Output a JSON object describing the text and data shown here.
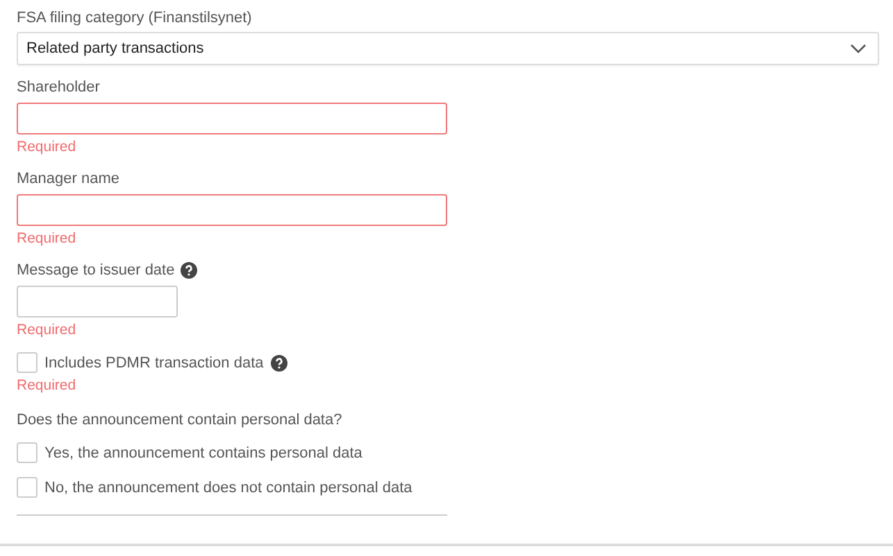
{
  "category": {
    "label": "FSA filing category (Finanstilsynet)",
    "value": "Related party transactions"
  },
  "fields": [
    {
      "label": "Shareholder",
      "kind": "text",
      "invalid": true,
      "help": false,
      "error": "Required"
    },
    {
      "label": "Manager name",
      "kind": "text",
      "invalid": true,
      "help": false,
      "error": "Required"
    },
    {
      "label": "Message to issuer date",
      "kind": "date",
      "invalid": false,
      "help": true,
      "error": "Required"
    }
  ],
  "pdmr": {
    "label": "Includes PDMR transaction data",
    "checked": false,
    "help": true,
    "error": "Required"
  },
  "personal_data": {
    "question": "Does the announcement contain personal data?",
    "options": [
      {
        "label": "Yes, the announcement contains personal data",
        "checked": false
      },
      {
        "label": "No, the announcement does not contain personal data",
        "checked": false
      }
    ]
  }
}
